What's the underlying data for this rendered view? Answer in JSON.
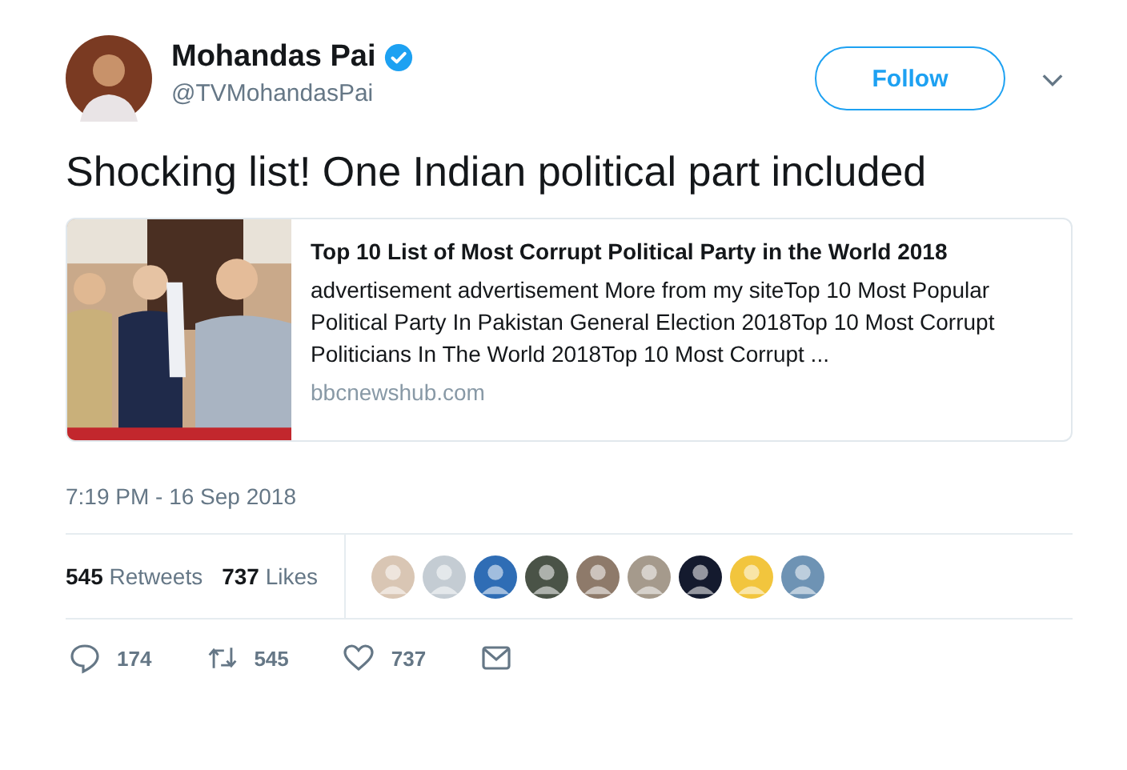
{
  "author": {
    "name": "Mohandas Pai",
    "verified": true,
    "handle": "@TVMohandasPai"
  },
  "follow_button": "Follow",
  "tweet_text": "Shocking list! One Indian political part included",
  "card": {
    "title": "Top 10 List of Most Corrupt Political Party in the World 2018",
    "description": "advertisement advertisement More from my siteTop 10 Most Popular Political Party In Pakistan General Election 2018Top 10 Most Corrupt Politicians In The World 2018Top 10 Most Corrupt ...",
    "domain": "bbcnewshub.com"
  },
  "timestamp": "7:19 PM - 16 Sep 2018",
  "stats": [
    {
      "count": "545",
      "label": "Retweets"
    },
    {
      "count": "737",
      "label": "Likes"
    }
  ],
  "likers": [
    {
      "color": "#d9c6b4"
    },
    {
      "color": "#c4ccd3"
    },
    {
      "color": "#2f6db5"
    },
    {
      "color": "#4a5347"
    },
    {
      "color": "#8e7a6a"
    },
    {
      "color": "#a59a8c"
    },
    {
      "color": "#141a2e"
    },
    {
      "color": "#f2c53d"
    },
    {
      "color": "#6e93b4"
    }
  ],
  "actions": [
    {
      "kind": "reply",
      "count": "174"
    },
    {
      "kind": "retweet",
      "count": "545"
    },
    {
      "kind": "like",
      "count": "737"
    },
    {
      "kind": "message"
    }
  ]
}
